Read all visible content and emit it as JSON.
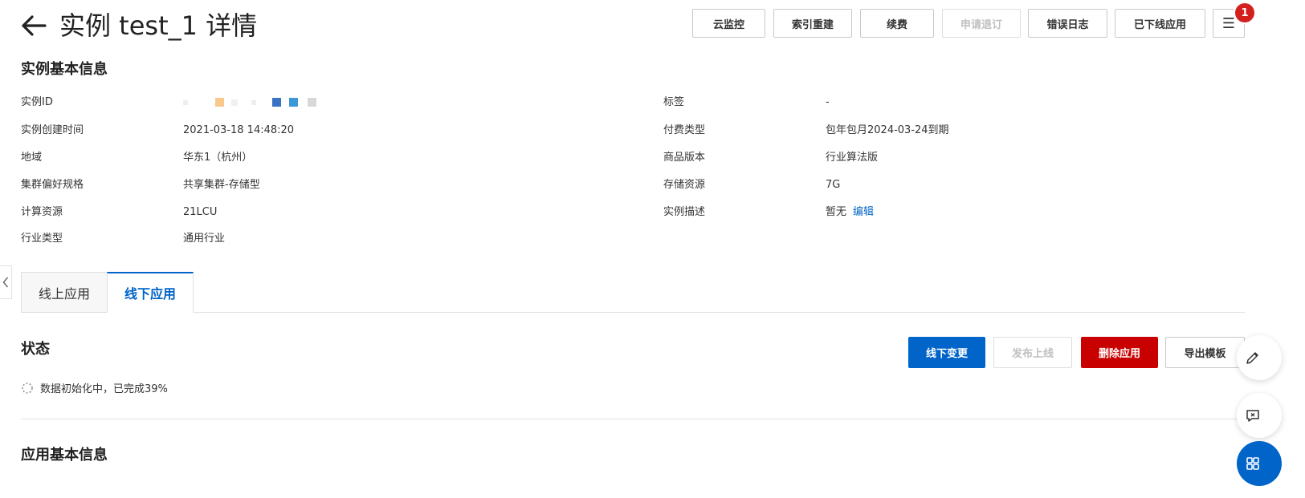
{
  "header": {
    "title": "实例 test_1 详情",
    "buttons": {
      "monitor": "云监控",
      "reindex": "索引重建",
      "renew": "续费",
      "refund": "申请退订",
      "error_log": "错误日志",
      "offline_apps": "已下线应用",
      "menu_icon": "☰"
    },
    "badge_count": "1"
  },
  "instance_info": {
    "section_title": "实例基本信息",
    "left": [
      {
        "label": "实例ID",
        "value": ""
      },
      {
        "label": "实例创建时间",
        "value": "2021-03-18 14:48:20"
      },
      {
        "label": "地域",
        "value": "华东1（杭州）"
      },
      {
        "label": "集群偏好规格",
        "value": "共享集群-存储型"
      },
      {
        "label": "计算资源",
        "value": "21LCU"
      },
      {
        "label": "行业类型",
        "value": "通用行业"
      }
    ],
    "right": [
      {
        "label": "标签",
        "value": "-"
      },
      {
        "label": "付费类型",
        "value": "包年包月2024-03-24到期"
      },
      {
        "label": "商品版本",
        "value": "行业算法版"
      },
      {
        "label": "存储资源",
        "value": "7G"
      },
      {
        "label": "实例描述",
        "value": "暂无",
        "link": "编辑"
      }
    ]
  },
  "tabs": [
    {
      "label": "线上应用",
      "active": false
    },
    {
      "label": "线下应用",
      "active": true
    }
  ],
  "status": {
    "section_title": "状态",
    "message": "数据初始化中，已完成39%",
    "progress_percent": 39
  },
  "actions": {
    "change": "线下变更",
    "publish": "发布上线",
    "delete": "删除应用",
    "export": "导出模板"
  },
  "app_info": {
    "section_title": "应用基本信息"
  },
  "colors": {
    "primary": "#0064c8",
    "danger": "#c80000",
    "badge": "#d41f1f"
  }
}
